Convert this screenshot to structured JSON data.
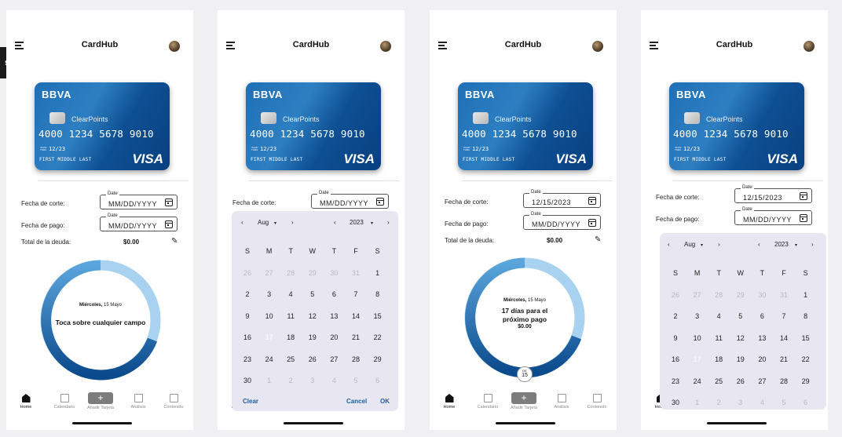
{
  "side_tab": "s",
  "phones": [
    {
      "title": "CardHub",
      "card": {
        "bank": "BBVA",
        "product": "ClearPoints",
        "number": "4000 1234 5678 9010",
        "valid_thru": "VALID THRU",
        "expiry": "12/23",
        "holder": "FIRST MIDDLE LAST",
        "network": "VISA"
      },
      "cut_label": "Fecha de corte:",
      "cut_legend": "Date",
      "cut_value": "MM/DD/YYYY",
      "pay_label": "Fecha de pago:",
      "pay_legend": "Date",
      "pay_value": "MM/DD/YYYY",
      "total_label": "Total de la deuda:",
      "total_value": "$0.00",
      "ring": {
        "date_day": "Miércoles,",
        "date_rest": " 15 Mayo",
        "main": "Toca sobre cualquier campo"
      }
    },
    {
      "title": "CardHub",
      "card": {
        "bank": "BBVA",
        "product": "ClearPoints",
        "number": "4000 1234 5678 9010",
        "valid_thru": "VALID THRU",
        "expiry": "12/23",
        "holder": "FIRST MIDDLE LAST",
        "network": "VISA"
      },
      "cut_label": "Fecha de corte:",
      "cut_legend": "Date",
      "cut_value": "MM/DD/YYYY"
    },
    {
      "title": "CardHub",
      "card": {
        "bank": "BBVA",
        "product": "ClearPoints",
        "number": "4000 1234 5678 9010",
        "valid_thru": "VALID THRU",
        "expiry": "12/23",
        "holder": "FIRST MIDDLE LAST",
        "network": "VISA"
      },
      "cut_label": "Fecha de corte:",
      "cut_legend": "Date",
      "cut_value": "12/15/2023",
      "pay_label": "Fecha de pago:",
      "pay_legend": "Date",
      "pay_value": "MM/DD/YYYY",
      "total_label": "Total de la deuda:",
      "total_value": "$0.00",
      "ring": {
        "date_day": "Miércoles,",
        "date_rest": " 15 Mayo",
        "line1": "17 días para el",
        "line2": "próximo pago",
        "amount": "$0.00"
      },
      "handle": {
        "top": "DE",
        "num": "15"
      }
    },
    {
      "title": "CardHub",
      "card": {
        "bank": "BBVA",
        "product": "ClearPoints",
        "number": "4000 1234 5678 9010",
        "valid_thru": "VALID THRU",
        "expiry": "12/23",
        "holder": "FIRST MIDDLE LAST",
        "network": "VISA"
      },
      "cut_label": "Fecha de corte:",
      "cut_legend": "Date",
      "cut_value": "12/15/2023",
      "pay_label": "Fecha de pago:",
      "pay_legend": "Date",
      "pay_value": "MM/DD/YYYY"
    }
  ],
  "nav": {
    "home": "Home",
    "calendar": "Calendario",
    "add": "Añadir Tarjeta",
    "analysis": "Análisis",
    "content": "Contenido",
    "add_symbol": "+"
  },
  "picker": {
    "month": "Aug",
    "year": "2023",
    "arrow_down": "▾",
    "prev": "‹",
    "next": "›",
    "weekdays": [
      "S",
      "M",
      "T",
      "W",
      "T",
      "F",
      "S"
    ],
    "days": [
      [
        "26",
        "27",
        "28",
        "29",
        "30",
        "31",
        "1"
      ],
      [
        "2",
        "3",
        "4",
        "5",
        "6",
        "7",
        "8"
      ],
      [
        "9",
        "10",
        "11",
        "12",
        "13",
        "14",
        "15"
      ],
      [
        "16",
        "17",
        "18",
        "19",
        "20",
        "21",
        "22"
      ],
      [
        "23",
        "24",
        "25",
        "26",
        "27",
        "28",
        "29"
      ],
      [
        "30",
        "1",
        "2",
        "3",
        "4",
        "5",
        "6"
      ]
    ],
    "selected": "17",
    "clear": "Clear",
    "cancel": "Cancel",
    "ok": "OK"
  },
  "colors": {
    "card_blue": "#0e4f93",
    "ring_light": "#a9d1f0",
    "ring_dark": "#0b4a8c",
    "picker_bg": "#e7e6f1"
  }
}
